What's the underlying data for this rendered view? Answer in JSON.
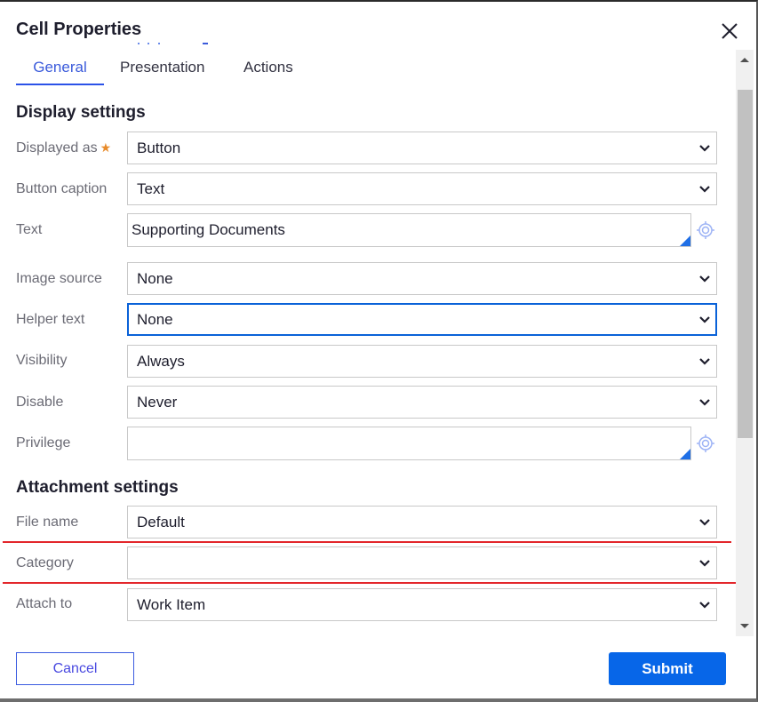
{
  "dialog": {
    "title": "Cell Properties",
    "close_icon": "close-icon"
  },
  "tabs": [
    {
      "label": "General",
      "active": true
    },
    {
      "label": "Presentation",
      "active": false
    },
    {
      "label": "Actions",
      "active": false
    }
  ],
  "display_settings": {
    "heading": "Display settings",
    "fields": {
      "displayed_as": {
        "label": "Displayed as",
        "required_mark": "★",
        "value": "Button"
      },
      "button_caption": {
        "label": "Button caption",
        "value": "Text"
      },
      "text": {
        "label": "Text",
        "value": "Supporting Documents"
      },
      "image_source": {
        "label": "Image source",
        "value": "None"
      },
      "helper_text": {
        "label": "Helper text",
        "value": "None"
      },
      "visibility": {
        "label": "Visibility",
        "value": "Always"
      },
      "disable": {
        "label": "Disable",
        "value": "Never"
      },
      "privilege": {
        "label": "Privilege",
        "value": ""
      }
    }
  },
  "attachment_settings": {
    "heading": "Attachment settings",
    "fields": {
      "file_name": {
        "label": "File name",
        "value": "Default"
      },
      "category": {
        "label": "Category",
        "value": ""
      },
      "attach_to": {
        "label": "Attach to",
        "value": "Work Item"
      }
    }
  },
  "footer": {
    "cancel_label": "Cancel",
    "submit_label": "Submit"
  },
  "colors": {
    "accent": "#2b52e8",
    "primary_button": "#0766e8",
    "focus_border": "#0a62d8",
    "required_mark": "#e88b2a",
    "annotation_line": "#e3262b"
  }
}
